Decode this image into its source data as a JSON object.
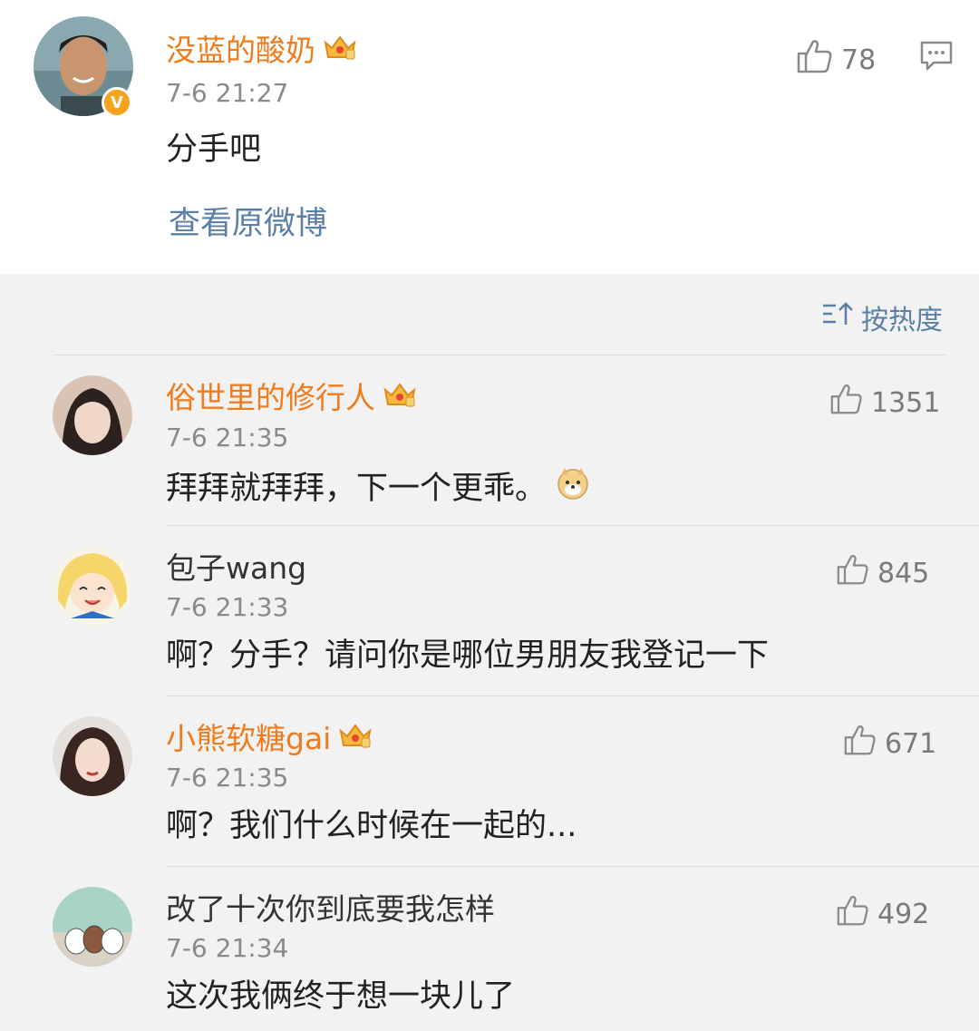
{
  "post": {
    "author": "没蓝的酸奶",
    "time": "7-6 21:27",
    "text": "分手吧",
    "likes": "78",
    "view_original": "查看原微博"
  },
  "sort_label": "按热度",
  "comments": [
    {
      "name": "俗世里的修行人",
      "vip": true,
      "time": "7-6 21:35",
      "text": "拜拜就拜拜，下一个更乖。",
      "likes": "1351"
    },
    {
      "name": "包子wang",
      "vip": false,
      "time": "7-6 21:33",
      "text": "啊？分手？请问你是哪位男朋友我登记一下",
      "likes": "845"
    },
    {
      "name": "小熊软糖gai",
      "vip": true,
      "time": "7-6 21:35",
      "text": "啊？我们什么时候在一起的...",
      "likes": "671"
    },
    {
      "name": "改了十次你到底要我怎样",
      "vip": false,
      "time": "7-6 21:34",
      "text": "这次我俩终于想一块儿了",
      "likes": "492"
    }
  ],
  "colors": {
    "name_vip": "#f07b1d",
    "link": "#5b7fa6",
    "gray": "#8a8a8a"
  }
}
